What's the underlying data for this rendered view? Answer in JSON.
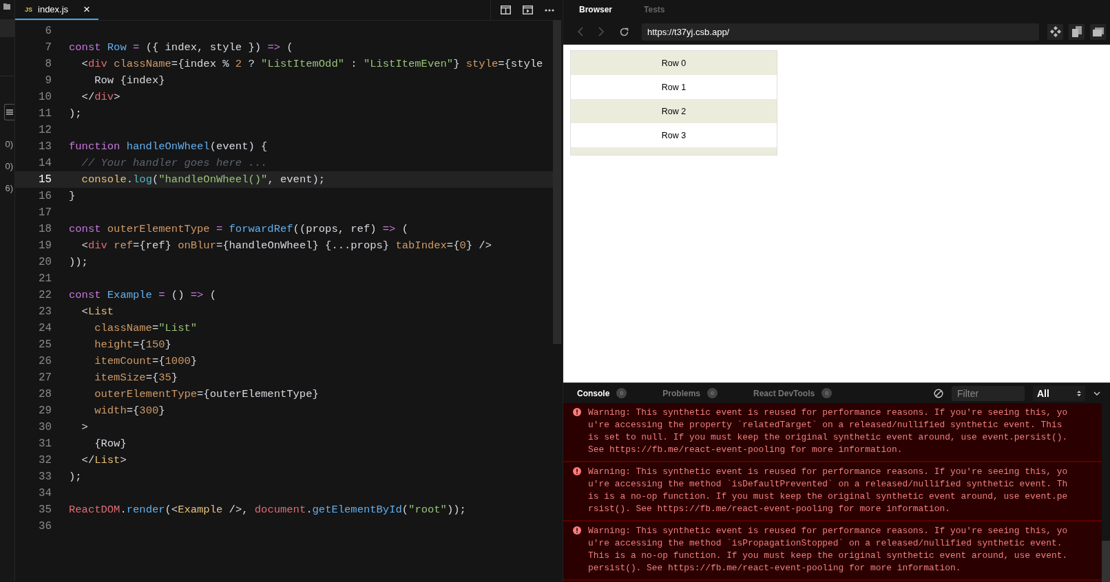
{
  "sidebar": {
    "items": [
      {
        "label": "0)"
      },
      {
        "label": "0)"
      },
      {
        "label": "6)"
      }
    ]
  },
  "editor": {
    "tabs": [
      {
        "badge": "JS",
        "label": "index.js",
        "close": "×",
        "selected": true
      }
    ],
    "lines": [
      {
        "number": "6",
        "active": false
      },
      {
        "number": "7",
        "active": false,
        "tokens": [
          {
            "kind": "kw",
            "t": "const "
          },
          {
            "kind": "fn",
            "t": "Row "
          },
          {
            "kind": "op",
            "t": "= "
          },
          {
            "kind": "p",
            "t": "({ index, style }) "
          },
          {
            "kind": "op",
            "t": "=> "
          },
          {
            "kind": "p",
            "t": "("
          }
        ]
      },
      {
        "number": "8",
        "active": false,
        "tokens": [
          {
            "kind": "p",
            "t": "  <"
          },
          {
            "kind": "tag",
            "t": "div "
          },
          {
            "kind": "attr",
            "t": "className"
          },
          {
            "kind": "p",
            "t": "={index % "
          },
          {
            "kind": "num",
            "t": "2"
          },
          {
            "kind": "p",
            "t": " ? "
          },
          {
            "kind": "str",
            "t": "\"ListItemOdd\""
          },
          {
            "kind": "p",
            "t": " : "
          },
          {
            "kind": "str",
            "t": "\"ListItemEven\""
          },
          {
            "kind": "p",
            "t": "} "
          },
          {
            "kind": "attr",
            "t": "style"
          },
          {
            "kind": "p",
            "t": "={style"
          }
        ]
      },
      {
        "number": "9",
        "active": false,
        "tokens": [
          {
            "kind": "p",
            "t": "    Row {index}"
          }
        ]
      },
      {
        "number": "10",
        "active": false,
        "tokens": [
          {
            "kind": "p",
            "t": "  </"
          },
          {
            "kind": "tag",
            "t": "div"
          },
          {
            "kind": "p",
            "t": ">"
          }
        ]
      },
      {
        "number": "11",
        "active": false,
        "tokens": [
          {
            "kind": "p",
            "t": ");"
          }
        ]
      },
      {
        "number": "12",
        "active": false
      },
      {
        "number": "13",
        "active": false,
        "tokens": [
          {
            "kind": "kw",
            "t": "function "
          },
          {
            "kind": "fn",
            "t": "handleOnWheel"
          },
          {
            "kind": "p",
            "t": "(event) {"
          }
        ]
      },
      {
        "number": "14",
        "active": false,
        "tokens": [
          {
            "kind": "cm",
            "t": "  // Your handler goes here ..."
          }
        ]
      },
      {
        "number": "15",
        "active": true,
        "tokens": [
          {
            "kind": "obj",
            "t": "  console"
          },
          {
            "kind": "p",
            "t": "."
          },
          {
            "kind": "method",
            "t": "log"
          },
          {
            "kind": "p",
            "t": "("
          },
          {
            "kind": "str",
            "t": "\"handleOnWheel()\""
          },
          {
            "kind": "p",
            "t": ", event);"
          }
        ]
      },
      {
        "number": "16",
        "active": false,
        "tokens": [
          {
            "kind": "p",
            "t": "}"
          }
        ]
      },
      {
        "number": "17",
        "active": false
      },
      {
        "number": "18",
        "active": false,
        "tokens": [
          {
            "kind": "kw",
            "t": "const "
          },
          {
            "kind": "var",
            "t": "outerElementType "
          },
          {
            "kind": "op",
            "t": "= "
          },
          {
            "kind": "fn",
            "t": "forwardRef"
          },
          {
            "kind": "p",
            "t": "((props, ref) "
          },
          {
            "kind": "op",
            "t": "=> "
          },
          {
            "kind": "p",
            "t": "("
          }
        ]
      },
      {
        "number": "19",
        "active": false,
        "tokens": [
          {
            "kind": "p",
            "t": "  <"
          },
          {
            "kind": "tag",
            "t": "div "
          },
          {
            "kind": "attr",
            "t": "ref"
          },
          {
            "kind": "p",
            "t": "={ref} "
          },
          {
            "kind": "attr",
            "t": "onBlur"
          },
          {
            "kind": "p",
            "t": "={handleOnWheel} {...props} "
          },
          {
            "kind": "attr",
            "t": "tabIndex"
          },
          {
            "kind": "p",
            "t": "={"
          },
          {
            "kind": "num",
            "t": "0"
          },
          {
            "kind": "p",
            "t": "} />"
          }
        ]
      },
      {
        "number": "20",
        "active": false,
        "tokens": [
          {
            "kind": "p",
            "t": "));"
          }
        ]
      },
      {
        "number": "21",
        "active": false
      },
      {
        "number": "22",
        "active": false,
        "tokens": [
          {
            "kind": "kw",
            "t": "const "
          },
          {
            "kind": "fn",
            "t": "Example "
          },
          {
            "kind": "op",
            "t": "= "
          },
          {
            "kind": "p",
            "t": "() "
          },
          {
            "kind": "op",
            "t": "=> "
          },
          {
            "kind": "p",
            "t": "("
          }
        ]
      },
      {
        "number": "23",
        "active": false,
        "tokens": [
          {
            "kind": "p",
            "t": "  <"
          },
          {
            "kind": "comp",
            "t": "List"
          }
        ]
      },
      {
        "number": "24",
        "active": false,
        "tokens": [
          {
            "kind": "attr",
            "t": "    className"
          },
          {
            "kind": "p",
            "t": "="
          },
          {
            "kind": "str",
            "t": "\"List\""
          }
        ]
      },
      {
        "number": "25",
        "active": false,
        "tokens": [
          {
            "kind": "attr",
            "t": "    height"
          },
          {
            "kind": "p",
            "t": "={"
          },
          {
            "kind": "num",
            "t": "150"
          },
          {
            "kind": "p",
            "t": "}"
          }
        ]
      },
      {
        "number": "26",
        "active": false,
        "tokens": [
          {
            "kind": "attr",
            "t": "    itemCount"
          },
          {
            "kind": "p",
            "t": "={"
          },
          {
            "kind": "num",
            "t": "1000"
          },
          {
            "kind": "p",
            "t": "}"
          }
        ]
      },
      {
        "number": "27",
        "active": false,
        "tokens": [
          {
            "kind": "attr",
            "t": "    itemSize"
          },
          {
            "kind": "p",
            "t": "={"
          },
          {
            "kind": "num",
            "t": "35"
          },
          {
            "kind": "p",
            "t": "}"
          }
        ]
      },
      {
        "number": "28",
        "active": false,
        "tokens": [
          {
            "kind": "attr",
            "t": "    outerElementType"
          },
          {
            "kind": "p",
            "t": "={outerElementType}"
          }
        ]
      },
      {
        "number": "29",
        "active": false,
        "tokens": [
          {
            "kind": "attr",
            "t": "    width"
          },
          {
            "kind": "p",
            "t": "={"
          },
          {
            "kind": "num",
            "t": "300"
          },
          {
            "kind": "p",
            "t": "}"
          }
        ]
      },
      {
        "number": "30",
        "active": false,
        "tokens": [
          {
            "kind": "p",
            "t": "  >"
          }
        ]
      },
      {
        "number": "31",
        "active": false,
        "tokens": [
          {
            "kind": "p",
            "t": "    {Row}"
          }
        ]
      },
      {
        "number": "32",
        "active": false,
        "tokens": [
          {
            "kind": "p",
            "t": "  </"
          },
          {
            "kind": "comp",
            "t": "List"
          },
          {
            "kind": "p",
            "t": ">"
          }
        ]
      },
      {
        "number": "33",
        "active": false,
        "tokens": [
          {
            "kind": "p",
            "t": ");"
          }
        ]
      },
      {
        "number": "34",
        "active": false
      },
      {
        "number": "35",
        "active": false,
        "tokens": [
          {
            "kind": "glob",
            "t": "ReactDOM"
          },
          {
            "kind": "p",
            "t": "."
          },
          {
            "kind": "fn",
            "t": "render"
          },
          {
            "kind": "p",
            "t": "(<"
          },
          {
            "kind": "comp",
            "t": "Example"
          },
          {
            "kind": "p",
            "t": " />, "
          },
          {
            "kind": "glob",
            "t": "document"
          },
          {
            "kind": "p",
            "t": "."
          },
          {
            "kind": "fn",
            "t": "getElementById"
          },
          {
            "kind": "p",
            "t": "("
          },
          {
            "kind": "str",
            "t": "\"root\""
          },
          {
            "kind": "p",
            "t": "));"
          }
        ]
      },
      {
        "number": "36",
        "active": false
      }
    ]
  },
  "preview_panel": {
    "tabs": [
      {
        "label": "Browser",
        "selected": true
      },
      {
        "label": "Tests",
        "selected": false
      }
    ],
    "url": "https://t37yj.csb.app/",
    "rows": [
      {
        "label": "Row 0",
        "shaded": true
      },
      {
        "label": "Row 1",
        "shaded": false
      },
      {
        "label": "Row 2",
        "shaded": true
      },
      {
        "label": "Row 3",
        "shaded": false
      }
    ]
  },
  "console": {
    "tabs": [
      {
        "label": "Console",
        "count": "0",
        "selected": true
      },
      {
        "label": "Problems",
        "count": "0",
        "selected": false
      },
      {
        "label": "React DevTools",
        "count": "0",
        "selected": false
      }
    ],
    "filter": {
      "placeholder": "Filter"
    },
    "level": "All",
    "messages": [
      {
        "kind": "warning",
        "text": "Warning: This synthetic event is reused for performance reasons. If you're seeing this, you're accessing the property `relatedTarget` on a released/nullified synthetic event. This is set to null. If you must keep the original synthetic event around, use event.persist(). See https://fb.me/react-event-pooling for more information."
      },
      {
        "kind": "warning",
        "text": "Warning: This synthetic event is reused for performance reasons. If you're seeing this, you're accessing the method `isDefaultPrevented` on a released/nullified synthetic event. This is a no-op function. If you must keep the original synthetic event around, use event.persist(). See https://fb.me/react-event-pooling for more information."
      },
      {
        "kind": "warning",
        "text": "Warning: This synthetic event is reused for performance reasons. If you're seeing this, you're accessing the method `isPropagationStopped` on a released/nullified synthetic event. This is a no-op function. If you must keep the original synthetic event around, use event.persist(). See https://fb.me/react-event-pooling for more information."
      }
    ]
  }
}
